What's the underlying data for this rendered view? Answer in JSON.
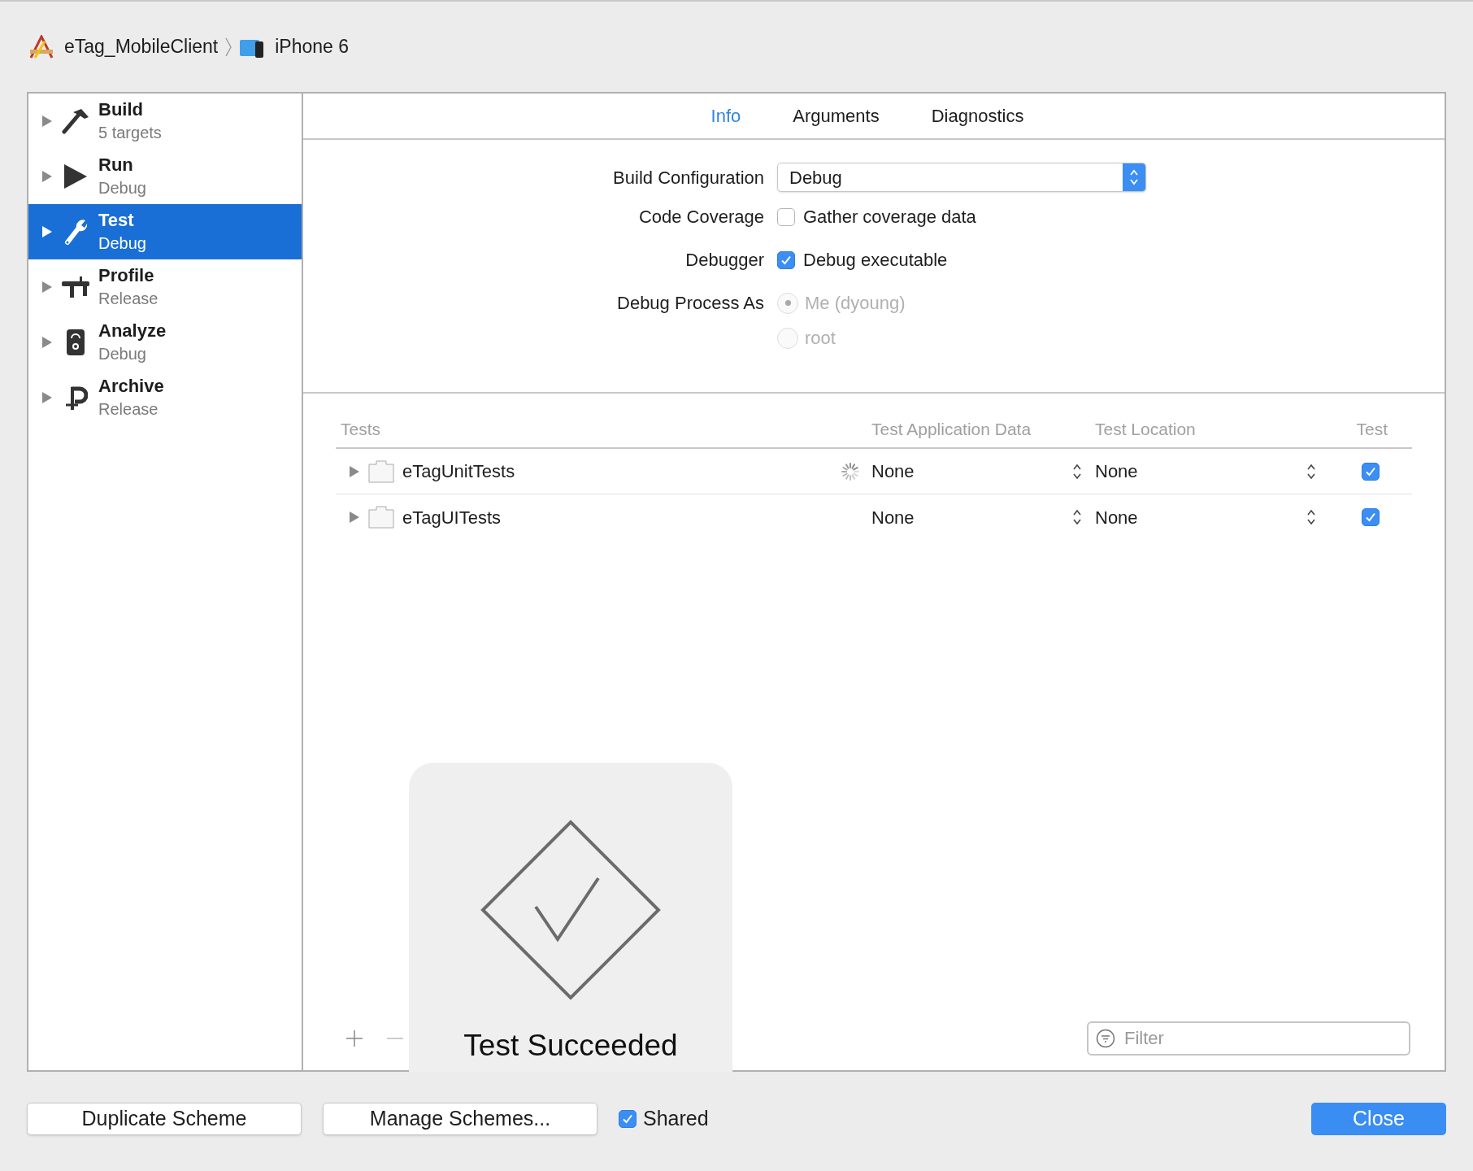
{
  "breadcrumb": [
    {
      "kind": "project",
      "label": "eTag_MobileClient"
    },
    {
      "kind": "device",
      "label": "iPhone 6"
    }
  ],
  "sidebar": {
    "items": [
      {
        "kind": "hammer",
        "title": "Build",
        "subtitle": "5 targets",
        "selected": false
      },
      {
        "kind": "play",
        "title": "Run",
        "subtitle": "Debug",
        "selected": false
      },
      {
        "kind": "wrench",
        "title": "Test",
        "subtitle": "Debug",
        "selected": true
      },
      {
        "kind": "caliper",
        "title": "Profile",
        "subtitle": "Release",
        "selected": false
      },
      {
        "kind": "meter",
        "title": "Analyze",
        "subtitle": "Debug",
        "selected": false
      },
      {
        "kind": "clamp",
        "title": "Archive",
        "subtitle": "Release",
        "selected": false
      }
    ]
  },
  "tabs": [
    {
      "label": "Info",
      "selected": true
    },
    {
      "label": "Arguments",
      "selected": false
    },
    {
      "label": "Diagnostics",
      "selected": false
    }
  ],
  "form": {
    "build_configuration": {
      "label": "Build Configuration",
      "value": "Debug"
    },
    "code_coverage": {
      "label": "Code Coverage",
      "option": "Gather coverage data",
      "checked": false
    },
    "debugger": {
      "label": "Debugger",
      "option": "Debug executable",
      "checked": true
    },
    "debug_process_as": {
      "label": "Debug Process As",
      "disabled": true,
      "options": [
        {
          "label": "Me (dyoung)",
          "selected": true
        },
        {
          "label": "root",
          "selected": false
        }
      ]
    }
  },
  "tests_table": {
    "columns": [
      "Tests",
      "Test Application Data",
      "Test Location",
      "Test"
    ],
    "rows": [
      {
        "name": "eTagUnitTests",
        "loading": true,
        "app_data": "None",
        "location": "None",
        "checked": true
      },
      {
        "name": "eTagUITests",
        "loading": false,
        "app_data": "None",
        "location": "None",
        "checked": true
      }
    ]
  },
  "filter": {
    "placeholder": "Filter"
  },
  "hud": {
    "message": "Test Succeeded"
  },
  "footer": {
    "buttons": [
      "Duplicate Scheme",
      "Manage Schemes..."
    ],
    "shared": {
      "label": "Shared",
      "checked": true
    },
    "close": "Close"
  }
}
